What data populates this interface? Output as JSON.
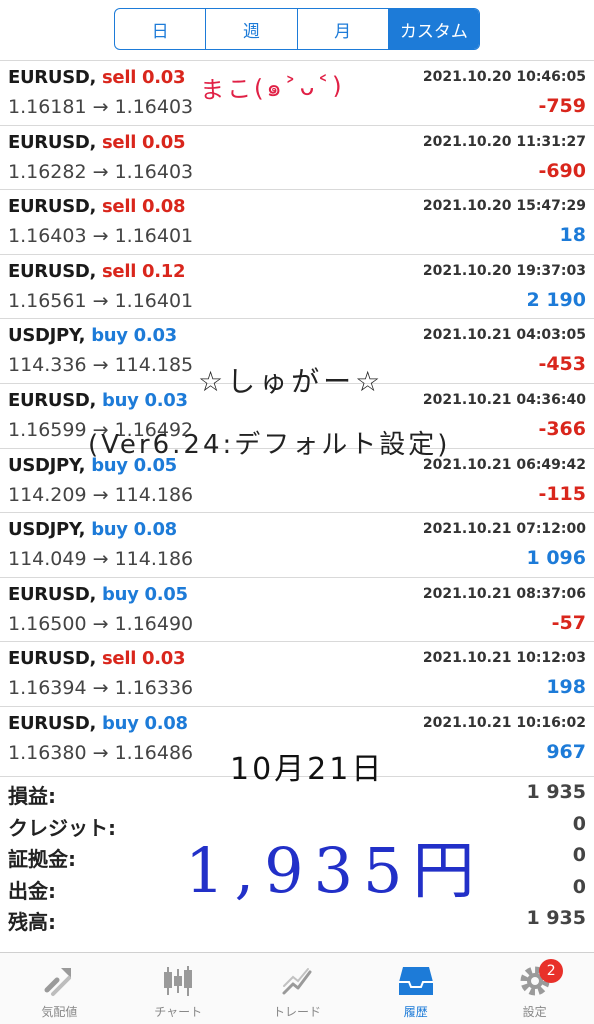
{
  "period_tabs": [
    {
      "label": "日",
      "active": false
    },
    {
      "label": "週",
      "active": false
    },
    {
      "label": "月",
      "active": false
    },
    {
      "label": "カスタム",
      "active": true
    }
  ],
  "trades": [
    {
      "pair": "EURUSD,",
      "side": "sell",
      "side_label": "sell 0.03",
      "prices": "1.16181 → 1.16403",
      "time": "2021.10.20 10:46:05",
      "profit": "-759"
    },
    {
      "pair": "EURUSD,",
      "side": "sell",
      "side_label": "sell 0.05",
      "prices": "1.16282 → 1.16403",
      "time": "2021.10.20 11:31:27",
      "profit": "-690"
    },
    {
      "pair": "EURUSD,",
      "side": "sell",
      "side_label": "sell 0.08",
      "prices": "1.16403 → 1.16401",
      "time": "2021.10.20 15:47:29",
      "profit": "18"
    },
    {
      "pair": "EURUSD,",
      "side": "sell",
      "side_label": "sell 0.12",
      "prices": "1.16561 → 1.16401",
      "time": "2021.10.20 19:37:03",
      "profit": "2 190"
    },
    {
      "pair": "USDJPY,",
      "side": "buy",
      "side_label": "buy 0.03",
      "prices": "114.336 → 114.185",
      "time": "2021.10.21 04:03:05",
      "profit": "-453"
    },
    {
      "pair": "EURUSD,",
      "side": "buy",
      "side_label": "buy 0.03",
      "prices": "1.16599 → 1.16492",
      "time": "2021.10.21 04:36:40",
      "profit": "-366"
    },
    {
      "pair": "USDJPY,",
      "side": "buy",
      "side_label": "buy 0.05",
      "prices": "114.209 → 114.186",
      "time": "2021.10.21 06:49:42",
      "profit": "-115"
    },
    {
      "pair": "USDJPY,",
      "side": "buy",
      "side_label": "buy 0.08",
      "prices": "114.049 → 114.186",
      "time": "2021.10.21 07:12:00",
      "profit": "1 096"
    },
    {
      "pair": "EURUSD,",
      "side": "buy",
      "side_label": "buy 0.05",
      "prices": "1.16500 → 1.16490",
      "time": "2021.10.21 08:37:06",
      "profit": "-57"
    },
    {
      "pair": "EURUSD,",
      "side": "sell",
      "side_label": "sell 0.03",
      "prices": "1.16394 → 1.16336",
      "time": "2021.10.21 10:12:03",
      "profit": "198"
    },
    {
      "pair": "EURUSD,",
      "side": "buy",
      "side_label": "buy 0.08",
      "prices": "1.16380 → 1.16486",
      "time": "2021.10.21 10:16:02",
      "profit": "967"
    }
  ],
  "summary": [
    {
      "label": "損益:",
      "value": "1 935"
    },
    {
      "label": "クレジット:",
      "value": "0"
    },
    {
      "label": "証拠金:",
      "value": "0"
    },
    {
      "label": "出金:",
      "value": "0"
    },
    {
      "label": "残高:",
      "value": "1 935"
    }
  ],
  "handwriting": {
    "mako": "まこ(๑˃ᴗ˂)",
    "sugar": "☆しゅがー☆",
    "version": "(Ver6.24:デフォルト設定)",
    "date": "10月21日",
    "yen": "1,935円"
  },
  "tabbar": [
    {
      "label": "気配値",
      "icon": "quotes-icon",
      "active": false
    },
    {
      "label": "チャート",
      "icon": "candlestick-chart-icon",
      "active": false
    },
    {
      "label": "トレード",
      "icon": "trade-icon",
      "active": false
    },
    {
      "label": "履歴",
      "icon": "history-inbox-icon",
      "active": true
    },
    {
      "label": "設定",
      "icon": "settings-gear-icon",
      "active": false,
      "badge": "2"
    }
  ],
  "colors": {
    "accent": "#1d7bd8",
    "sell": "#d9261c",
    "loss": "#d9261c",
    "gain": "#1d7bd8"
  }
}
